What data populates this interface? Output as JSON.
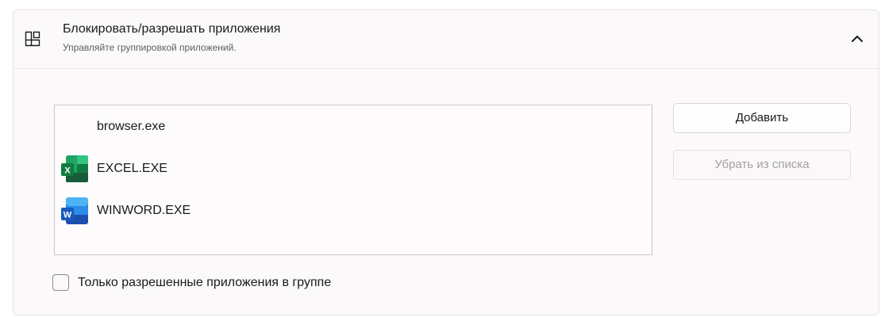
{
  "section": {
    "title": "Блокировать/разрешать приложения",
    "subtitle": "Управляйте группировкой приложений.",
    "icon": "app-group-icon",
    "expanded": true,
    "chevron_icon": "chevron-up-icon"
  },
  "apps": [
    {
      "name": "browser.exe",
      "icon": "none"
    },
    {
      "name": "EXCEL.EXE",
      "icon": "excel-icon",
      "badge": "X"
    },
    {
      "name": "WINWORD.EXE",
      "icon": "word-icon",
      "badge": "W"
    }
  ],
  "buttons": {
    "add_label": "Добавить",
    "remove_label": "Убрать из списка",
    "remove_disabled": true
  },
  "checkbox": {
    "label": "Только разрешенные приложения в группе",
    "checked": false
  },
  "colors": {
    "excel_green": "#107c41",
    "word_blue": "#185abd",
    "panel_bg": "#fcf9fb"
  }
}
